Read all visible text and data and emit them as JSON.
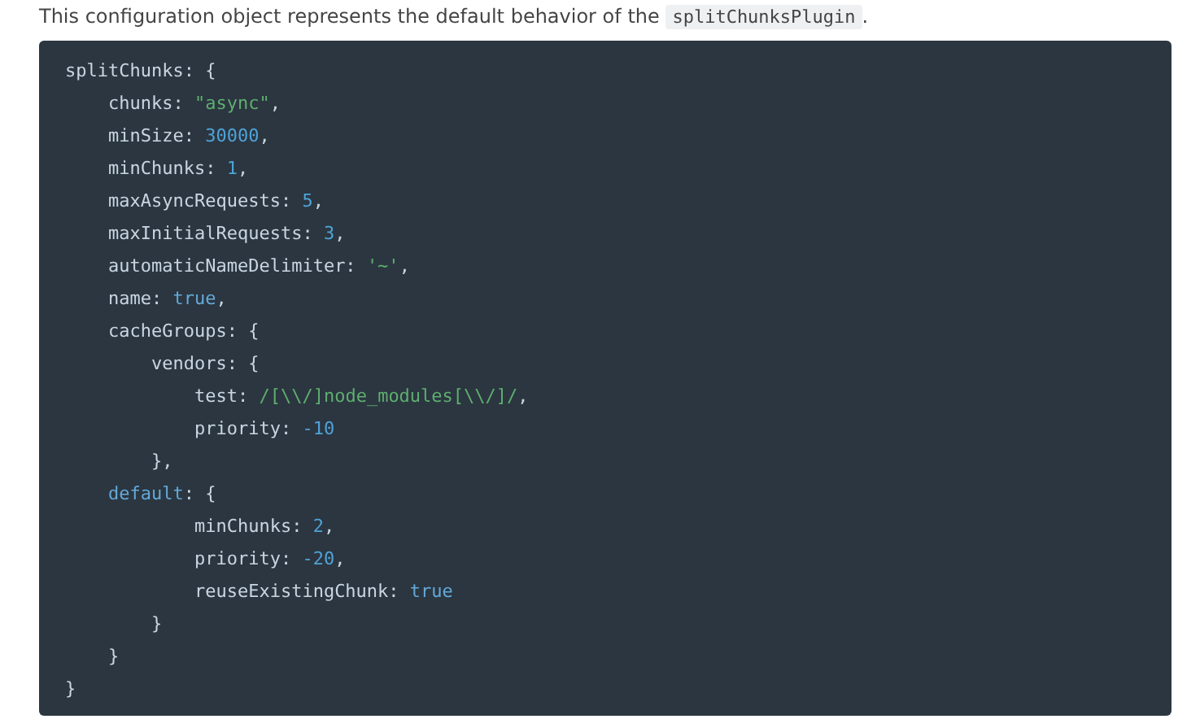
{
  "intro": {
    "text": "This configuration object represents the default behavior of the",
    "code": "splitChunksPlugin",
    "end": "."
  },
  "code_lines": [
    [
      {
        "text": "splitChunks: {",
        "kind": "plain"
      }
    ],
    [
      {
        "text": "    chunks: ",
        "kind": "plain"
      },
      {
        "text": "\"async\"",
        "kind": "string"
      },
      {
        "text": ",",
        "kind": "plain"
      }
    ],
    [
      {
        "text": "    minSize: ",
        "kind": "plain"
      },
      {
        "text": "30000",
        "kind": "number"
      },
      {
        "text": ",",
        "kind": "plain"
      }
    ],
    [
      {
        "text": "    minChunks: ",
        "kind": "plain"
      },
      {
        "text": "1",
        "kind": "number"
      },
      {
        "text": ",",
        "kind": "plain"
      }
    ],
    [
      {
        "text": "    maxAsyncRequests: ",
        "kind": "plain"
      },
      {
        "text": "5",
        "kind": "number"
      },
      {
        "text": ",",
        "kind": "plain"
      }
    ],
    [
      {
        "text": "    maxInitialRequests: ",
        "kind": "plain"
      },
      {
        "text": "3",
        "kind": "number"
      },
      {
        "text": ",",
        "kind": "plain"
      }
    ],
    [
      {
        "text": "    automaticNameDelimiter: ",
        "kind": "plain"
      },
      {
        "text": "'~'",
        "kind": "string"
      },
      {
        "text": ",",
        "kind": "plain"
      }
    ],
    [
      {
        "text": "    name: ",
        "kind": "plain"
      },
      {
        "text": "true",
        "kind": "keyword"
      },
      {
        "text": ",",
        "kind": "plain"
      }
    ],
    [
      {
        "text": "    cacheGroups: {",
        "kind": "plain"
      }
    ],
    [
      {
        "text": "        vendors: {",
        "kind": "plain"
      }
    ],
    [
      {
        "text": "            test: ",
        "kind": "plain"
      },
      {
        "text": "/[\\\\/]node_modules[\\\\/]/",
        "kind": "string"
      },
      {
        "text": ",",
        "kind": "plain"
      }
    ],
    [
      {
        "text": "            priority: ",
        "kind": "plain"
      },
      {
        "text": "-10",
        "kind": "number"
      }
    ],
    [
      {
        "text": "        },",
        "kind": "plain"
      }
    ],
    [
      {
        "text": "    default",
        "kind": "keyword"
      },
      {
        "text": ": {",
        "kind": "plain"
      }
    ],
    [
      {
        "text": "            minChunks: ",
        "kind": "plain"
      },
      {
        "text": "2",
        "kind": "number"
      },
      {
        "text": ",",
        "kind": "plain"
      }
    ],
    [
      {
        "text": "            priority: ",
        "kind": "plain"
      },
      {
        "text": "-20",
        "kind": "number"
      },
      {
        "text": ",",
        "kind": "plain"
      }
    ],
    [
      {
        "text": "            reuseExistingChunk: ",
        "kind": "plain"
      },
      {
        "text": "true",
        "kind": "keyword"
      }
    ],
    [
      {
        "text": "        }",
        "kind": "plain"
      }
    ],
    [
      {
        "text": "    }",
        "kind": "plain"
      }
    ],
    [
      {
        "text": "}",
        "kind": "plain"
      }
    ]
  ]
}
